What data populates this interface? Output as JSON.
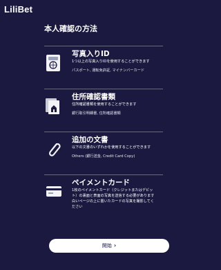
{
  "brand": {
    "logo_text": "LiliBet"
  },
  "page": {
    "title": "本人確認の方法"
  },
  "methods": [
    {
      "title": "写真入りID",
      "desc": "1つ以上の写真入りIDを使用することができます",
      "sub": "パスポート, 運転免許証, マイナンバーカード",
      "icon": "passport-icon"
    },
    {
      "title": "住所確認書類",
      "desc": "住所確認書類を使用することができます",
      "sub": "銀行取引明細書, 住所確認書類",
      "icon": "document-stack-icon"
    },
    {
      "title": "追加の文書",
      "desc": "以下の文書のいずれかを使用することができます",
      "sub": "Others (銀行送金, Credit Card Copy)",
      "icon": "paperclip-icon"
    },
    {
      "title": "ペイメントカード",
      "desc_lines": [
        "1枚のペイメントカード（クレジットまたはデビッ",
        "ト）の裏面と表面の写真を送信する必要があります",
        "白いページの上に置いたカードの写真を撮影してく",
        "ださい"
      ],
      "icon": "credit-card-icon"
    }
  ],
  "footer": {
    "start_label": "開始",
    "start_icon": "chevron-right-icon"
  },
  "colors": {
    "background": "#1b1940",
    "button_bg": "#ffffff",
    "button_text": "#1b1940"
  }
}
